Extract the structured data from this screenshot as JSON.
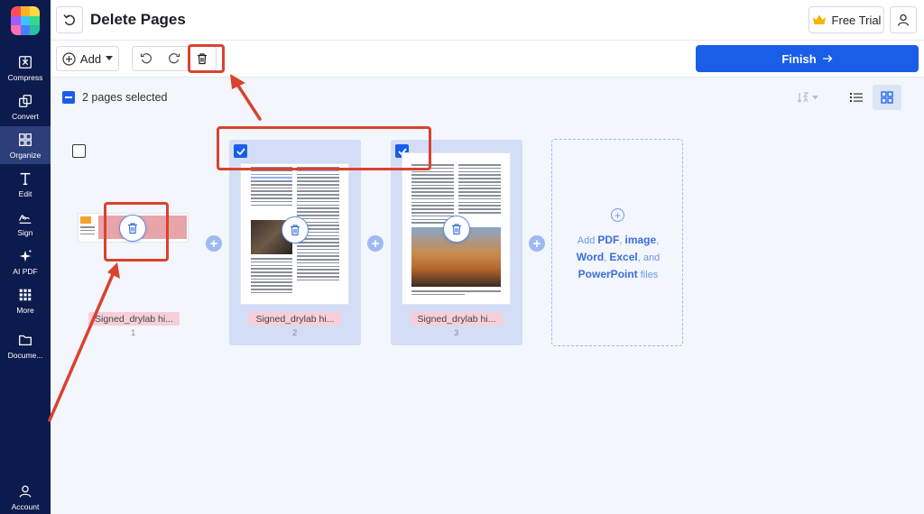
{
  "sidebar": {
    "items": [
      {
        "label": "Compress",
        "icon": "compress-icon"
      },
      {
        "label": "Convert",
        "icon": "convert-icon"
      },
      {
        "label": "Organize",
        "icon": "organize-icon",
        "active": true
      },
      {
        "label": "Edit",
        "icon": "edit-icon"
      },
      {
        "label": "Sign",
        "icon": "sign-icon"
      },
      {
        "label": "AI PDF",
        "icon": "ai-sparkle-icon"
      },
      {
        "label": "More",
        "icon": "more-grid-icon"
      },
      {
        "label": "Docume...",
        "icon": "folder-icon"
      }
    ],
    "account_label": "Account"
  },
  "header": {
    "title": "Delete Pages",
    "free_trial_label": "Free Trial"
  },
  "toolbar": {
    "add_label": "Add",
    "finish_label": "Finish"
  },
  "selection": {
    "text": "2 pages selected"
  },
  "pages": [
    {
      "label": "Signed_drylab hi...",
      "number": "1",
      "selected": false
    },
    {
      "label": "Signed_drylab hi...",
      "number": "2",
      "selected": true
    },
    {
      "label": "Signed_drylab hi...",
      "number": "3",
      "selected": true
    }
  ],
  "add_files": {
    "prefix": "Add ",
    "pdf": "PDF",
    "sep1": ", ",
    "image": "image",
    "sep2": ",",
    "word": "Word",
    "sep3": ", ",
    "excel": "Excel",
    "sep4": ", and",
    "powerpoint": "PowerPoint",
    "suffix": " files"
  },
  "colors": {
    "sidebar_bg": "#0c1b4d",
    "accent": "#1a5ee8",
    "annotation_red": "#d9432e",
    "selected_card": "#d3def6"
  }
}
